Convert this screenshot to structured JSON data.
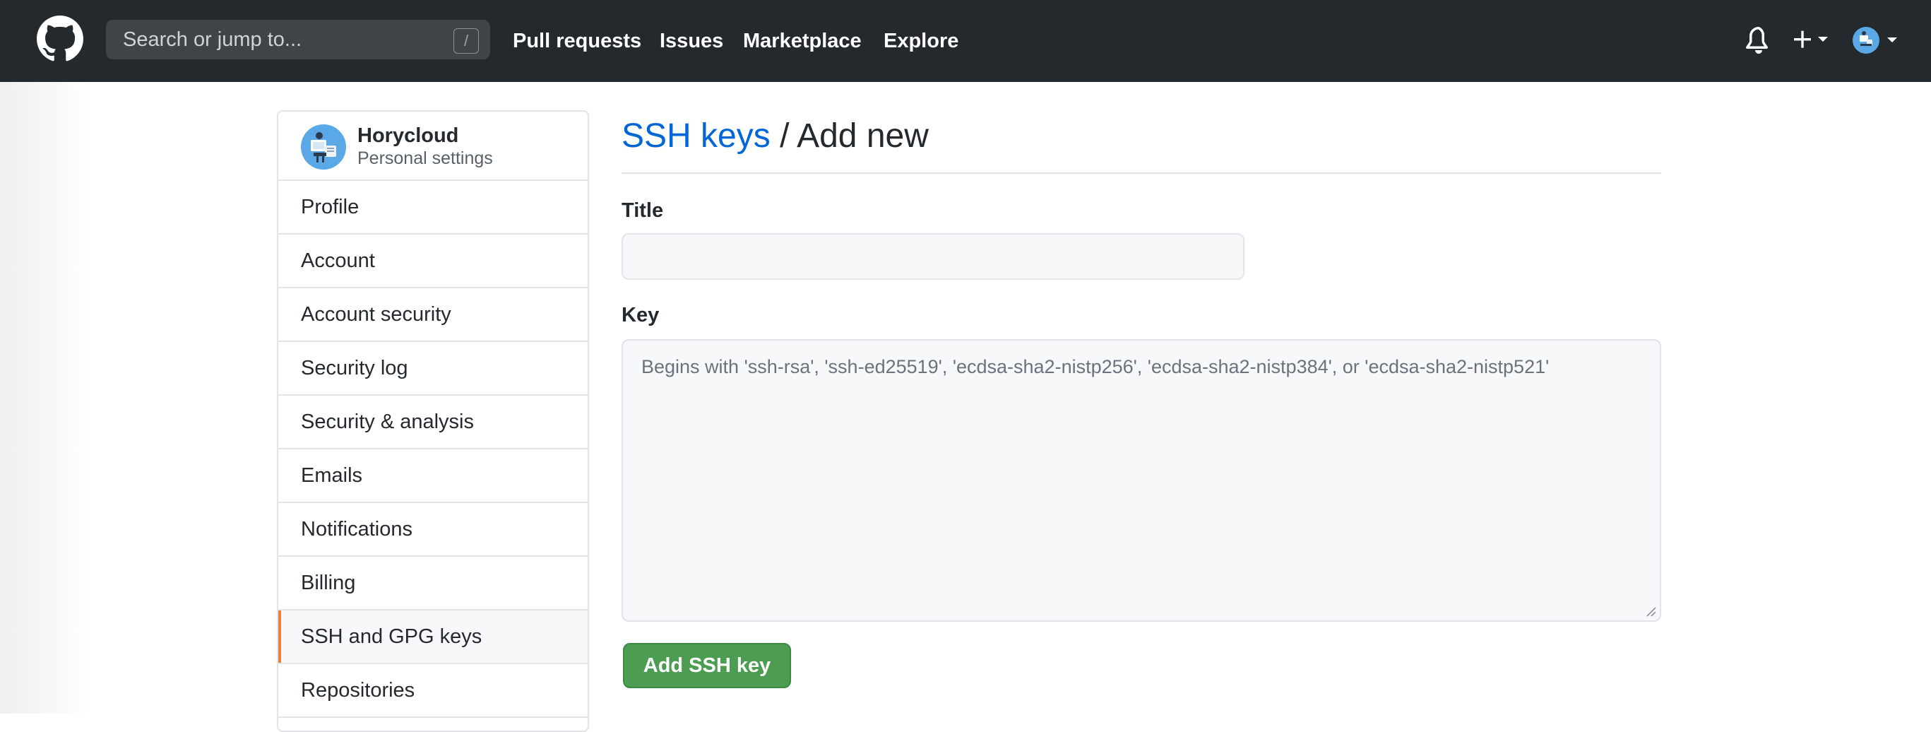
{
  "header": {
    "search_placeholder": "Search or jump to...",
    "search_shortcut": "/",
    "nav": [
      {
        "label": "Pull requests"
      },
      {
        "label": "Issues"
      },
      {
        "label": "Marketplace"
      },
      {
        "label": "Explore"
      }
    ],
    "icons": {
      "logo": "github-octocat-icon",
      "bell": "notification-bell-icon",
      "plus": "plus-icon",
      "caret": "caret-down-icon"
    }
  },
  "sidebar": {
    "user_name": "Horycloud",
    "user_subtitle": "Personal settings",
    "selected_index": 8,
    "items": [
      {
        "label": "Profile"
      },
      {
        "label": "Account"
      },
      {
        "label": "Account security"
      },
      {
        "label": "Security log"
      },
      {
        "label": "Security & analysis"
      },
      {
        "label": "Emails"
      },
      {
        "label": "Notifications"
      },
      {
        "label": "Billing"
      },
      {
        "label": "SSH and GPG keys"
      },
      {
        "label": "Repositories"
      }
    ]
  },
  "main": {
    "breadcrumb_link": "SSH keys",
    "breadcrumb_separator": " / ",
    "breadcrumb_current": "Add new",
    "title_label": "Title",
    "title_value": "",
    "key_label": "Key",
    "key_placeholder": "Begins with 'ssh-rsa', 'ssh-ed25519', 'ecdsa-sha2-nistp256', 'ecdsa-sha2-nistp384', or 'ecdsa-sha2-nistp521'",
    "submit_label": "Add SSH key"
  },
  "colors": {
    "header_bg": "#24292e",
    "link_blue": "#0366d6",
    "button_green": "#4c9c52",
    "selected_accent": "#e36209"
  }
}
